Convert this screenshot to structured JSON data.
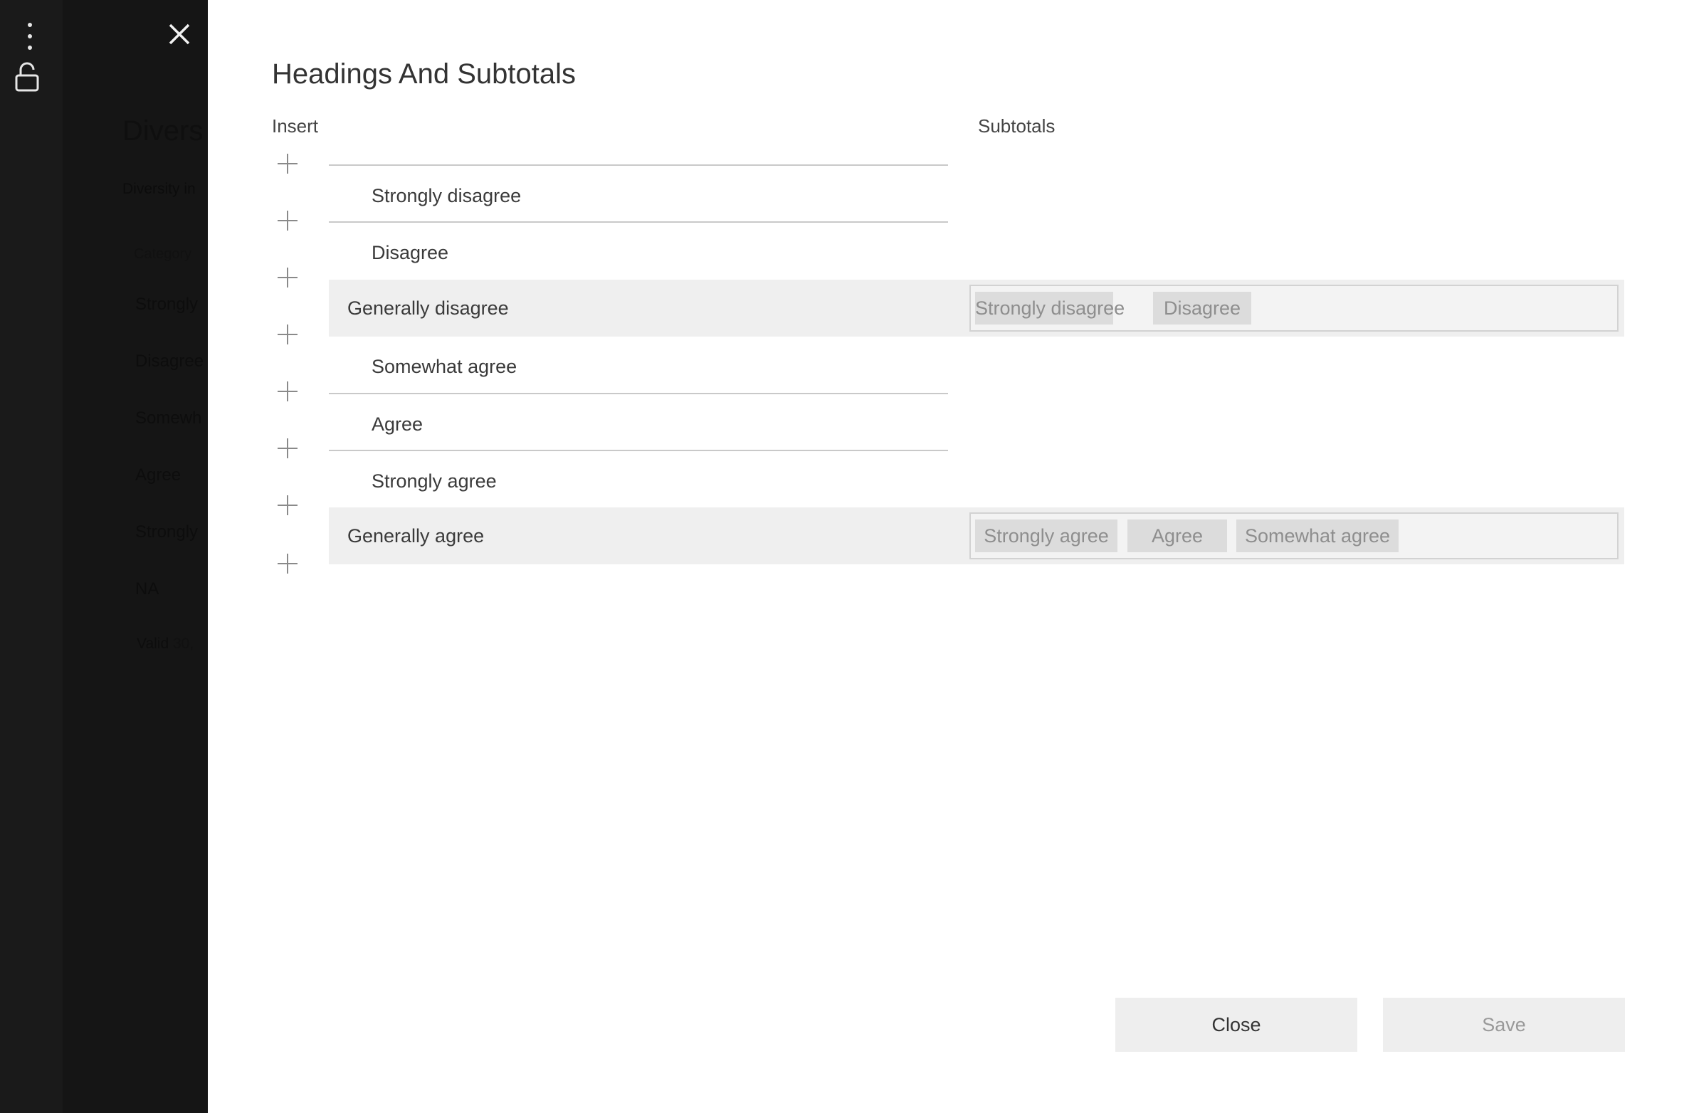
{
  "background": {
    "title": "Divers",
    "subtitle": "Diversity in",
    "column_header": "Category",
    "rows": [
      "Strongly",
      "Disagree",
      "Somewh",
      "Agree",
      "Strongly",
      "NA"
    ],
    "valid_label": "Valid",
    "valid_value": "30,"
  },
  "toolbar": {
    "menu_icon": "vertical-dots-icon",
    "lock_icon": "unlock-icon",
    "close_icon": "close-icon"
  },
  "dialog": {
    "title": "Headings And Subtotals",
    "insert_label": "Insert",
    "subtotals_label": "Subtotals",
    "insert_icon": "plus-icon",
    "categories": {
      "c1": "Strongly disagree",
      "c2": "Disagree",
      "c3": "Somewhat agree",
      "c4": "Agree",
      "c5": "Strongly agree"
    },
    "subtotals": [
      {
        "name": "Generally disagree",
        "members": [
          "Strongly disagree",
          "Disagree"
        ]
      },
      {
        "name": "Generally agree",
        "members": [
          "Strongly agree",
          "Agree",
          "Somewhat agree"
        ]
      }
    ],
    "close_label": "Close",
    "save_label": "Save"
  },
  "colors": {
    "sidebar": "#1a1a1a",
    "panel": "#ffffff",
    "band": "#efefef",
    "chip": "#dcdcdc",
    "button": "#eeeeee"
  }
}
